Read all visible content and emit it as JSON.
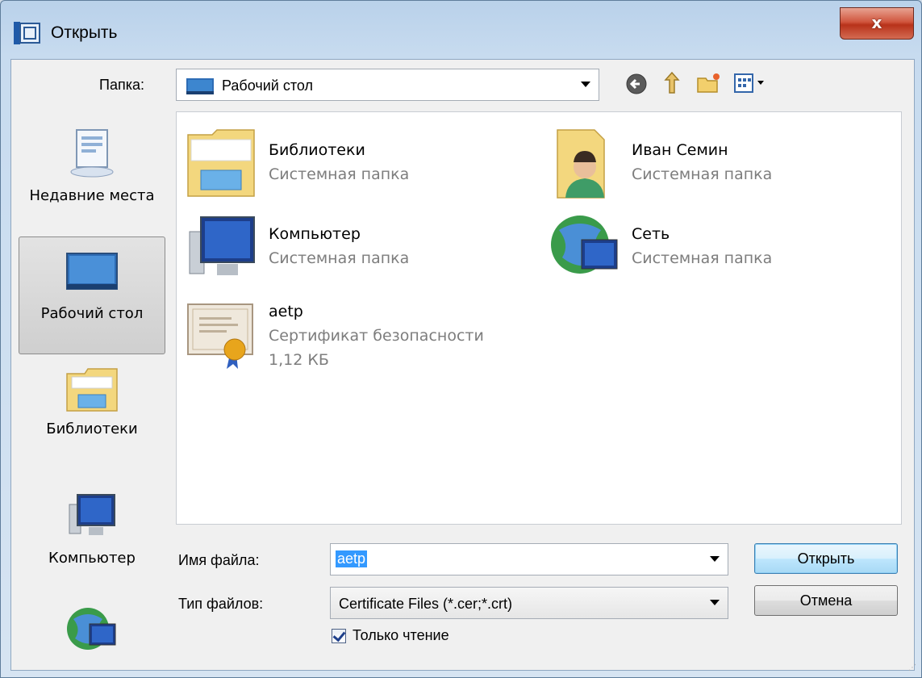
{
  "dialog": {
    "title": "Открыть",
    "close_label": "x"
  },
  "toolbar": {
    "folder_label": "Папка:",
    "current_folder": "Рабочий стол",
    "icons": [
      "back-icon",
      "up-folder-icon",
      "new-folder-icon",
      "view-menu-icon"
    ]
  },
  "places": [
    {
      "label": "Недавние места",
      "icon": "recent-places-icon"
    },
    {
      "label": "Рабочий стол",
      "icon": "desktop-icon",
      "selected": true
    },
    {
      "label": "Библиотеки",
      "icon": "libraries-icon"
    },
    {
      "label": "Компьютер",
      "icon": "computer-icon"
    },
    {
      "label": "",
      "icon": "network-icon"
    }
  ],
  "files": [
    {
      "name": "Библиотеки",
      "type": "Системная папка",
      "size": "",
      "icon": "libraries-folder-icon"
    },
    {
      "name": "Иван Семин",
      "type": "Системная папка",
      "size": "",
      "icon": "user-folder-icon"
    },
    {
      "name": "Компьютер",
      "type": "Системная папка",
      "size": "",
      "icon": "computer-icon"
    },
    {
      "name": "Сеть",
      "type": "Системная папка",
      "size": "",
      "icon": "network-icon"
    },
    {
      "name": "aetp",
      "type": "Сертификат безопасности",
      "size": "1,12 КБ",
      "icon": "certificate-icon"
    }
  ],
  "form": {
    "filename_label": "Имя файла:",
    "filename_value": "aetp",
    "filetype_label": "Тип файлов:",
    "filetype_value": "Certificate Files (*.cer;*.crt)",
    "readonly_label": "Только чтение",
    "readonly_checked": true
  },
  "buttons": {
    "open_label": "Открыть",
    "cancel_label": "Отмена"
  }
}
